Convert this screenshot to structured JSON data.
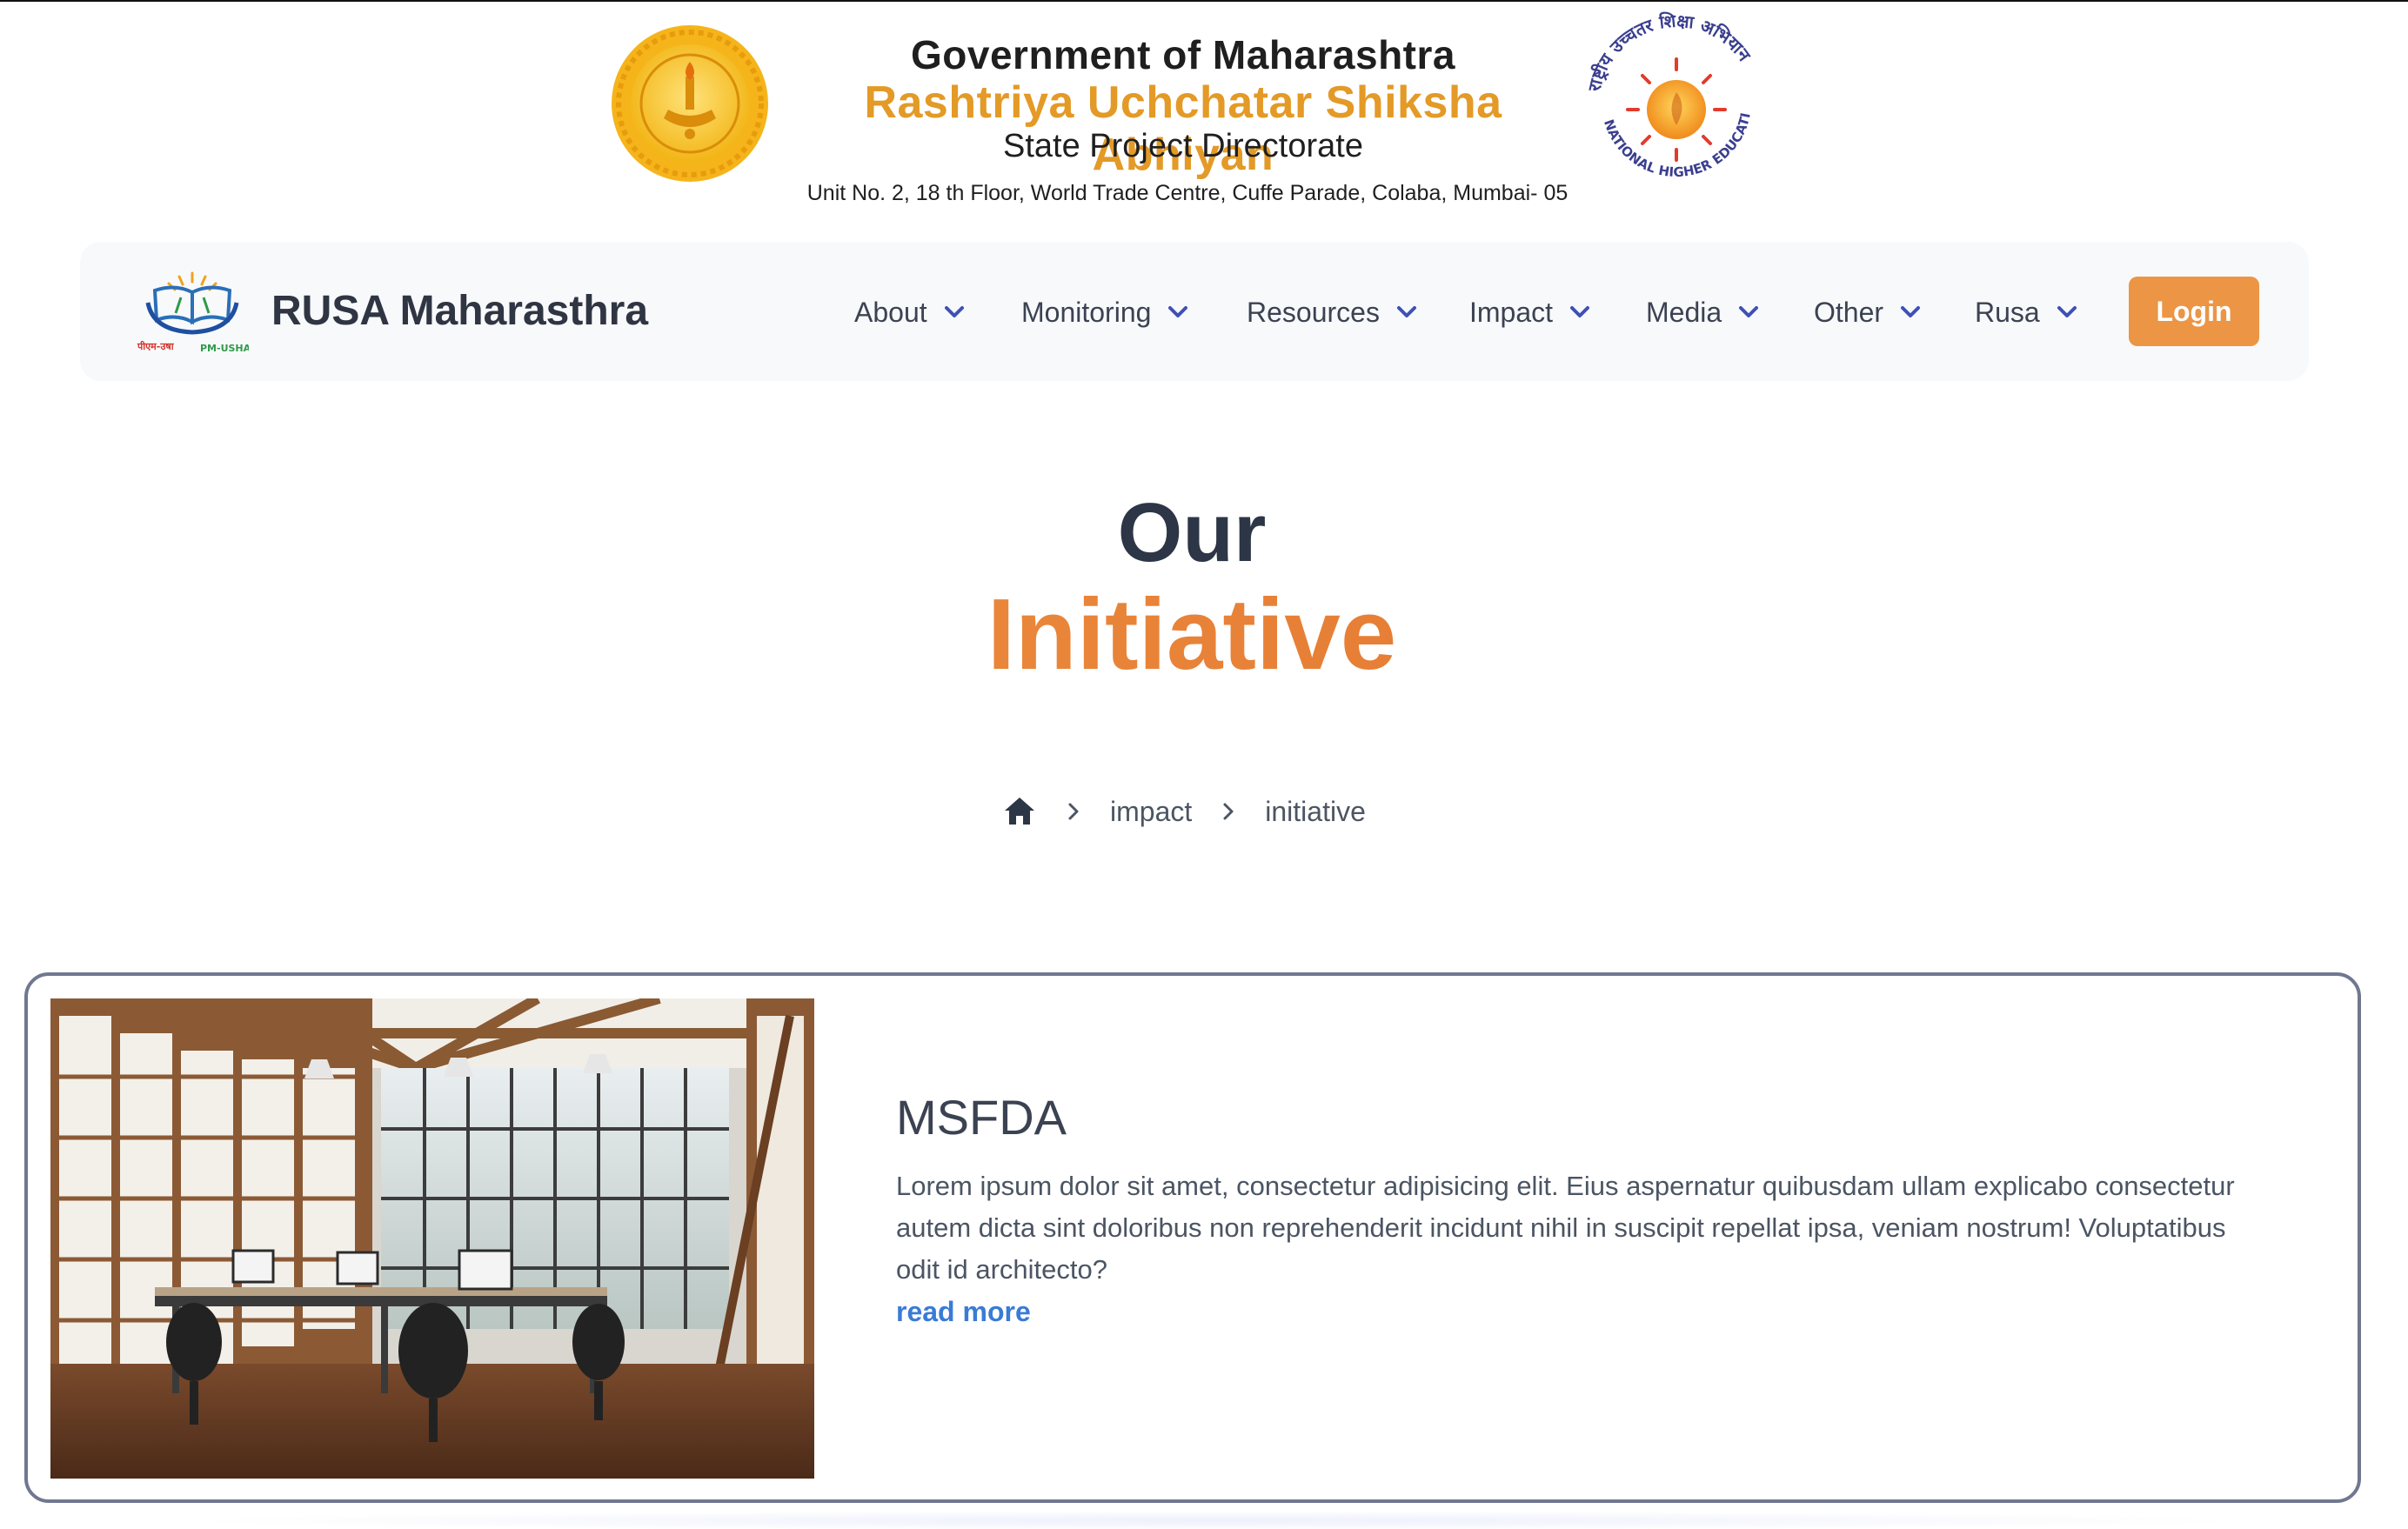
{
  "header": {
    "line1": "Government of Maharashtra",
    "line2": "Rashtriya Uchchatar Shiksha Abhiyan",
    "line3": "State Project Directorate",
    "address": "Unit No. 2, 18 th Floor, World Trade Centre, Cuffe Parade, Colaba, Mumbai- 05",
    "right_seal_top_text": "राष्ट्रीय उच्चतर शिक्षा अभियान",
    "right_seal_bottom_text": "NATIONAL HIGHER EDUCATION MISSION"
  },
  "navbar": {
    "brand_logo_text_left": "पीएम-उषा",
    "brand_logo_text_right": "PM-USHA",
    "brand_name": "RUSA Maharasthra",
    "items": [
      {
        "label": "About",
        "icon": "chevron-down-icon"
      },
      {
        "label": "Monitoring",
        "icon": "chevron-down-icon"
      },
      {
        "label": "Resources",
        "icon": "chevron-down-icon"
      },
      {
        "label": "Impact",
        "icon": "chevron-down-icon"
      },
      {
        "label": "Media",
        "icon": "chevron-down-icon"
      },
      {
        "label": "Other",
        "icon": "chevron-down-icon"
      },
      {
        "label": "Rusa",
        "icon": "chevron-down-icon"
      }
    ],
    "login_label": "Login",
    "accent_color": "#ec9545",
    "chevron_color": "#3f51b5"
  },
  "page_title": {
    "line1": "Our",
    "line2": "Initiative"
  },
  "breadcrumb": {
    "home_icon": "home-icon",
    "items": [
      "impact",
      "initiative"
    ]
  },
  "card": {
    "image": "office-library-photo",
    "title": "MSFDA",
    "description": "Lorem ipsum dolor sit amet, consectetur adipisicing elit. Eius aspernatur quibusdam ullam explicabo consectetur autem dicta sint doloribus non reprehenderit incidunt nihil in suscipit repellat ipsa, veniam nostrum! Voluptatibus odit id architecto?",
    "link_label": "read more"
  }
}
